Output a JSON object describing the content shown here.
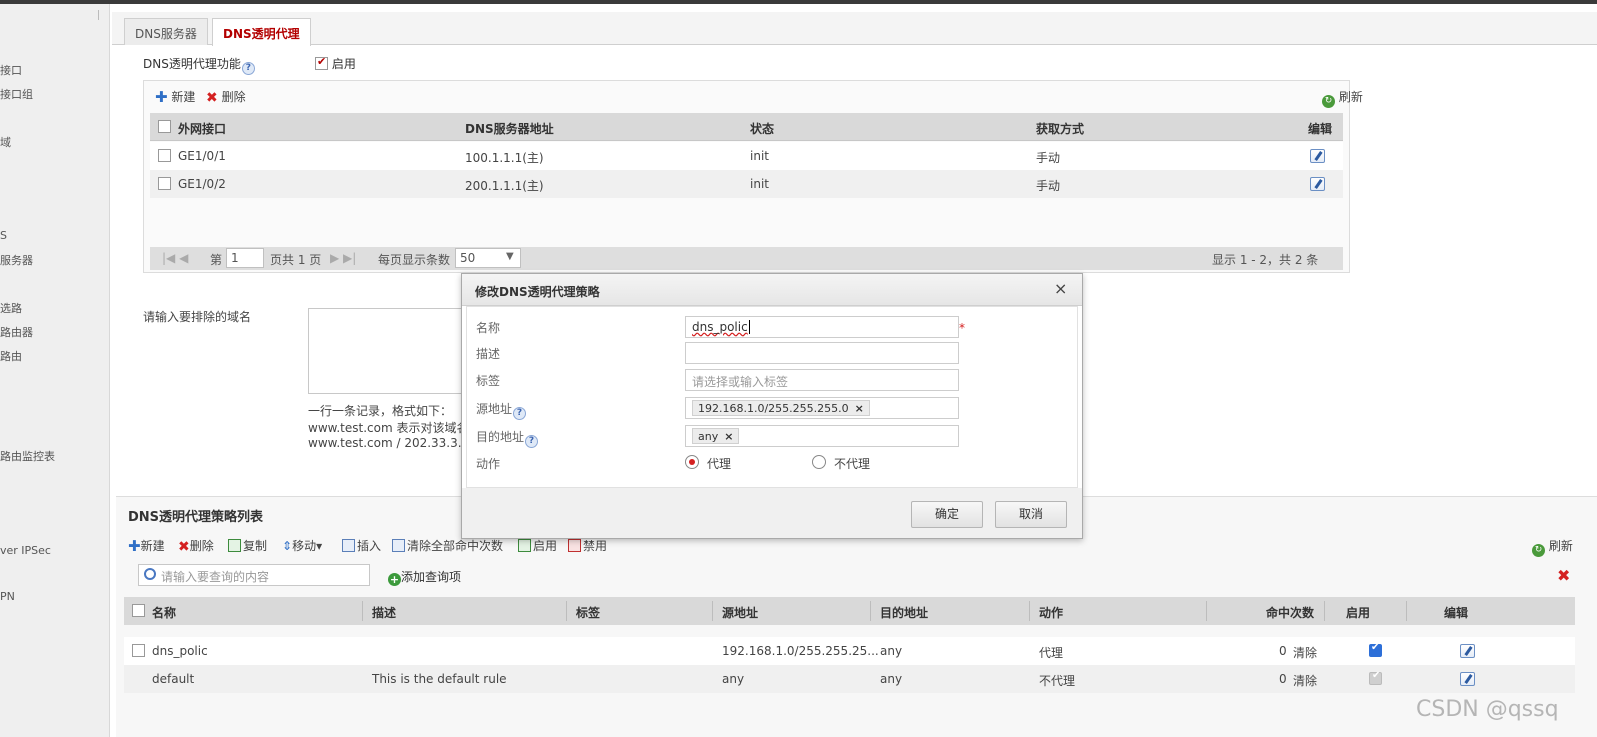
{
  "leftnav": {
    "items": [
      "接口",
      "接口组",
      "域",
      "",
      "S",
      "服务器",
      "选路",
      "路由器",
      "路由",
      "",
      "路由监控表",
      "",
      "ver IPSec",
      "PN"
    ]
  },
  "tabs": [
    {
      "label": "DNS服务器",
      "active": false
    },
    {
      "label": "DNS透明代理",
      "active": true
    }
  ],
  "feature": {
    "label": "DNS透明代理功能",
    "help": "?",
    "enable_label": "启用",
    "enabled": true
  },
  "toolbar1": {
    "new": "新建",
    "delete": "删除",
    "refresh": "刷新"
  },
  "table1": {
    "headers": [
      "外网接口",
      "DNS服务器地址",
      "状态",
      "获取方式",
      "编辑"
    ],
    "rows": [
      {
        "iface": "GE1/0/1",
        "dns": "100.1.1.1(主)",
        "state": "init",
        "mode": "手动"
      },
      {
        "iface": "GE1/0/2",
        "dns": "200.1.1.1(主)",
        "state": "init",
        "mode": "手动"
      }
    ]
  },
  "pager": {
    "page_prefix": "第",
    "page": "1",
    "page_suffix": "页共 1 页",
    "per_page_label": "每页显示条数",
    "per_page": "50",
    "summary": "显示 1 - 2，共 2 条"
  },
  "exclude": {
    "label": "请输入要排除的域名",
    "hint1": "一行一条记录，格式如下：",
    "hint2": "www.test.com 表示对该域名",
    "hint3": "www.test.com / 202.33.3.3"
  },
  "policy_section": {
    "title": "DNS透明代理策略列表",
    "toolbar": {
      "new": "新建",
      "delete": "删除",
      "copy": "复制",
      "move": "移动▾",
      "insert": "插入",
      "clear_hits": "清除全部命中次数",
      "enable": "启用",
      "disable": "禁用",
      "refresh": "刷新"
    },
    "search_placeholder": "请输入要查询的内容",
    "add_query": "添加查询项",
    "headers": [
      "名称",
      "描述",
      "标签",
      "源地址",
      "目的地址",
      "动作",
      "命中次数",
      "启用",
      "编辑"
    ],
    "rows": [
      {
        "name": "dns_polic",
        "desc": "",
        "tag": "",
        "src": "192.168.1.0/255.255.25...",
        "dst": "any",
        "action": "代理",
        "hits": "0",
        "clear": "清除",
        "enabled": true
      },
      {
        "name": "default",
        "desc": "This is the default rule",
        "tag": "",
        "src": "any",
        "dst": "any",
        "action": "不代理",
        "hits": "0",
        "clear": "清除",
        "enabled": true
      }
    ]
  },
  "dialog": {
    "title": "修改DNS透明代理策略",
    "close": "×",
    "labels": {
      "name": "名称",
      "desc": "描述",
      "tag": "标签",
      "src": "源地址",
      "dst": "目的地址",
      "action": "动作"
    },
    "name_value": "dns_polic",
    "tag_placeholder": "请选择或输入标签",
    "src_chip": "192.168.1.0/255.255.255.0",
    "dst_chip": "any",
    "action_proxy": "代理",
    "action_noproxy": "不代理",
    "ok": "确定",
    "cancel": "取消"
  },
  "watermark": "CSDN @qssq"
}
